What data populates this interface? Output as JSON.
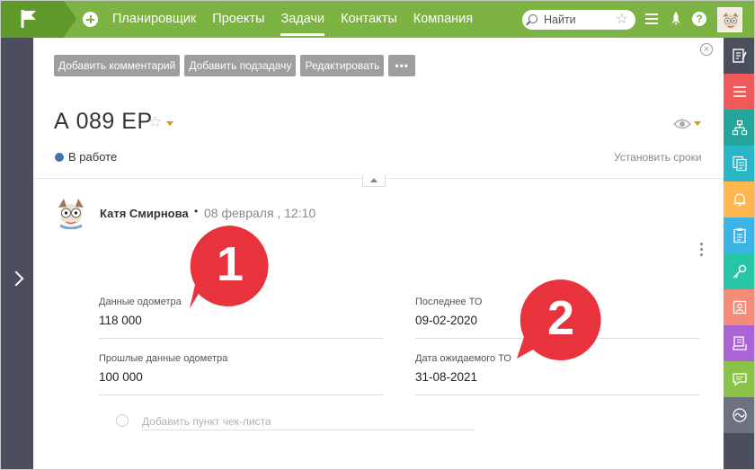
{
  "nav": {
    "items": [
      "Планировщик",
      "Проекты",
      "Задачи",
      "Контакты",
      "Компания"
    ],
    "active_index": 2
  },
  "search": {
    "placeholder": "Найти"
  },
  "toolbar": {
    "add_comment": "Добавить комментарий",
    "add_subtask": "Добавить подзадачу",
    "edit": "Редактировать",
    "more": "•••"
  },
  "task": {
    "title": "А 089 ЕР",
    "status": "В работе",
    "status_color": "#3f74b5",
    "set_deadline": "Установить сроки"
  },
  "comment": {
    "author": "Катя Смирнова",
    "separator": "•",
    "date": "08 февраля , 12:10"
  },
  "fields": [
    {
      "label": "Данные одометра",
      "value": "118 000"
    },
    {
      "label": "Последнее ТО",
      "value": "09-02-2020"
    },
    {
      "label": "Прошлые данные одометра",
      "value": "100 000"
    },
    {
      "label": "Дата ожидаемого ТО",
      "value": "31-08-2021"
    }
  ],
  "checklist": {
    "placeholder": "Добавить пункт чек-листа"
  },
  "annotations": {
    "first": "1",
    "second": "2"
  },
  "colors": {
    "topbar": "#7cb342",
    "sidebar": "#4a4e5d",
    "annotation": "#e8323c",
    "right_icons": [
      "#4a4e5d",
      "#ef5a5a",
      "#26a69a",
      "#29b6c6",
      "#ffb74d",
      "#3db4e6",
      "#26c6a6",
      "#f48c79",
      "#ab64d6",
      "#8bc34a",
      "#6d7180"
    ]
  },
  "right_icons": [
    "note-icon",
    "list-icon",
    "structure-icon",
    "documents-icon",
    "bell-icon",
    "clipboard-icon",
    "key-icon",
    "contact-card-icon",
    "tray-icon",
    "chat-icon",
    "activity-icon"
  ]
}
